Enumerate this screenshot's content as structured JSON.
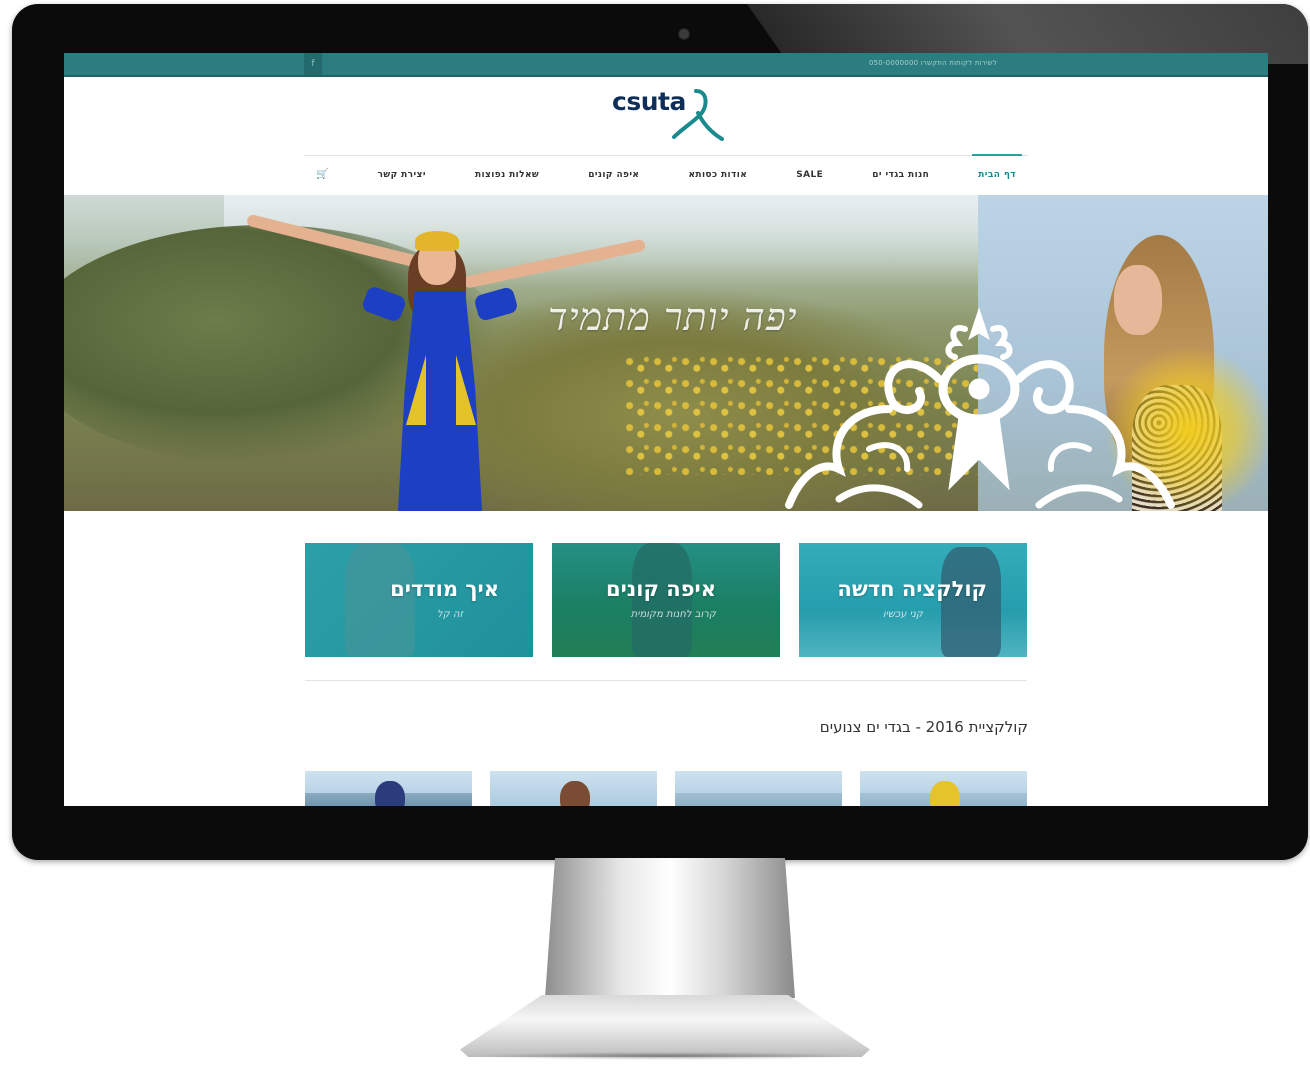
{
  "site": {
    "logo_text": "csuta",
    "topbar": {
      "facebook_label": "f",
      "contact_text": "לשירות לקוחות התקשרו 050-0000000"
    },
    "nav": {
      "items": [
        {
          "label": "דף הבית",
          "active": true
        },
        {
          "label": "חנות בגדי ים",
          "active": false
        },
        {
          "label": "SALE",
          "active": false
        },
        {
          "label": "אודות כסותא",
          "active": false
        },
        {
          "label": "איפה קונים",
          "active": false
        },
        {
          "label": "שאלות נפוצות",
          "active": false
        },
        {
          "label": "יצירת קשר",
          "active": false
        }
      ],
      "cart_icon": "cart-icon"
    },
    "hero": {
      "tagline": "יפה יותר מתמיד"
    },
    "tiles": [
      {
        "title": "קולקציה חדשה",
        "subtitle": "קני עכשיו"
      },
      {
        "title": "איפה קונים",
        "subtitle": "קרוב לחנות מקומית"
      },
      {
        "title": "איך מודדים",
        "subtitle": "זה קל"
      }
    ],
    "section_title": "קולקציית 2016 - בגדי ים צנועים",
    "colors": {
      "accent": "#2c7d7f",
      "logo": "#0f2f5a",
      "tile_teal": "#1f9aa5"
    }
  }
}
